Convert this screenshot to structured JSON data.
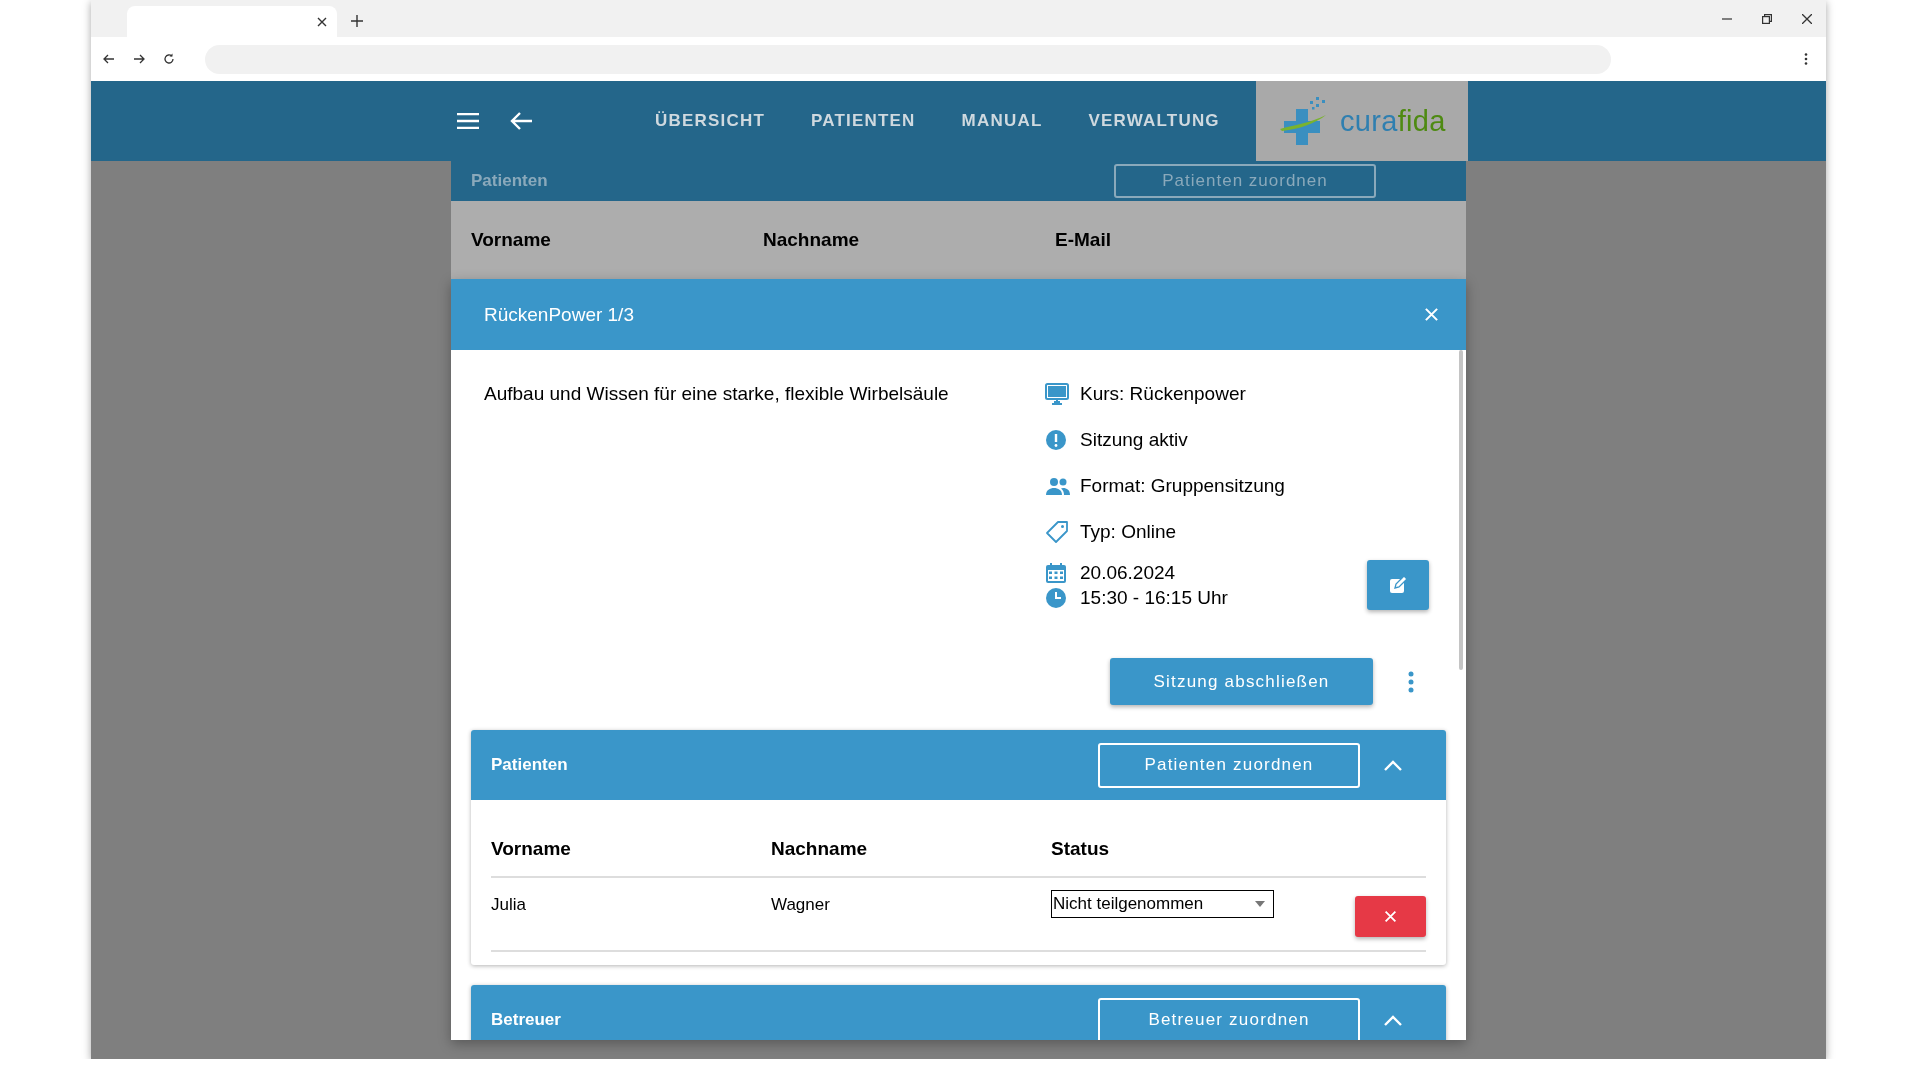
{
  "header": {
    "nav": [
      {
        "label": "ÜBERSICHT"
      },
      {
        "label": "PATIENTEN"
      },
      {
        "label": "MANUAL"
      },
      {
        "label": "VERWALTUNG"
      }
    ],
    "logo": {
      "text_1": "cura",
      "text_2": "fida"
    }
  },
  "background_page": {
    "section_title": "Patienten",
    "assign_button": "Patienten zuordnen",
    "columns": [
      "Vorname",
      "Nachname",
      "E-Mail"
    ]
  },
  "modal": {
    "title": "RückenPower 1/3",
    "description": "Aufbau und Wissen für eine starke, flexible Wirbelsäule",
    "details": [
      {
        "kind": "course",
        "text": "Kurs: Rückenpower"
      },
      {
        "kind": "status",
        "text": "Sitzung aktiv"
      },
      {
        "kind": "format",
        "text": "Format: Gruppensitzung"
      },
      {
        "kind": "type",
        "text": "Typ: Online"
      }
    ],
    "date": "20.06.2024",
    "time": "15:30 - 16:15 Uhr",
    "finish_button": "Sitzung abschließen",
    "sections": [
      {
        "title": "Patienten",
        "assign_button": "Patienten zuordnen",
        "expanded": true,
        "columns": [
          "Vorname",
          "Nachname",
          "Status"
        ],
        "rows": [
          {
            "first_name": "Julia",
            "last_name": "Wagner",
            "status": "Nicht teilgenommen"
          }
        ]
      },
      {
        "title": "Betreuer",
        "assign_button": "Betreuer zuordnen",
        "expanded": true
      }
    ]
  }
}
